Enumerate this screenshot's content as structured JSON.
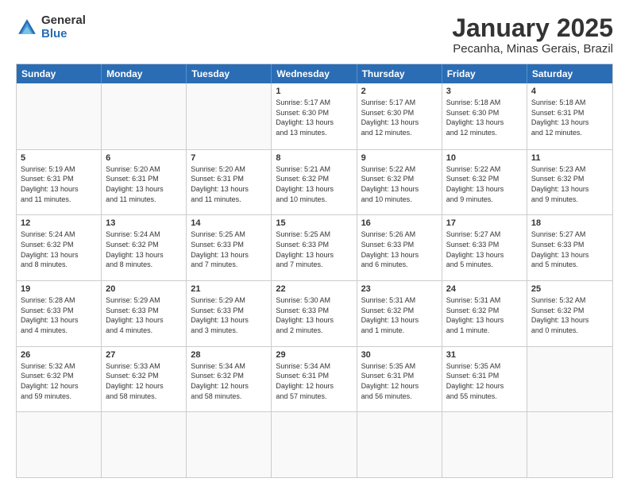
{
  "logo": {
    "general": "General",
    "blue": "Blue"
  },
  "header": {
    "title": "January 2025",
    "subtitle": "Pecanha, Minas Gerais, Brazil"
  },
  "weekdays": [
    "Sunday",
    "Monday",
    "Tuesday",
    "Wednesday",
    "Thursday",
    "Friday",
    "Saturday"
  ],
  "rows": [
    [
      {
        "day": "",
        "info": ""
      },
      {
        "day": "",
        "info": ""
      },
      {
        "day": "",
        "info": ""
      },
      {
        "day": "1",
        "info": "Sunrise: 5:17 AM\nSunset: 6:30 PM\nDaylight: 13 hours\nand 13 minutes."
      },
      {
        "day": "2",
        "info": "Sunrise: 5:17 AM\nSunset: 6:30 PM\nDaylight: 13 hours\nand 12 minutes."
      },
      {
        "day": "3",
        "info": "Sunrise: 5:18 AM\nSunset: 6:30 PM\nDaylight: 13 hours\nand 12 minutes."
      },
      {
        "day": "4",
        "info": "Sunrise: 5:18 AM\nSunset: 6:31 PM\nDaylight: 13 hours\nand 12 minutes."
      }
    ],
    [
      {
        "day": "5",
        "info": "Sunrise: 5:19 AM\nSunset: 6:31 PM\nDaylight: 13 hours\nand 11 minutes."
      },
      {
        "day": "6",
        "info": "Sunrise: 5:20 AM\nSunset: 6:31 PM\nDaylight: 13 hours\nand 11 minutes."
      },
      {
        "day": "7",
        "info": "Sunrise: 5:20 AM\nSunset: 6:31 PM\nDaylight: 13 hours\nand 11 minutes."
      },
      {
        "day": "8",
        "info": "Sunrise: 5:21 AM\nSunset: 6:32 PM\nDaylight: 13 hours\nand 10 minutes."
      },
      {
        "day": "9",
        "info": "Sunrise: 5:22 AM\nSunset: 6:32 PM\nDaylight: 13 hours\nand 10 minutes."
      },
      {
        "day": "10",
        "info": "Sunrise: 5:22 AM\nSunset: 6:32 PM\nDaylight: 13 hours\nand 9 minutes."
      },
      {
        "day": "11",
        "info": "Sunrise: 5:23 AM\nSunset: 6:32 PM\nDaylight: 13 hours\nand 9 minutes."
      }
    ],
    [
      {
        "day": "12",
        "info": "Sunrise: 5:24 AM\nSunset: 6:32 PM\nDaylight: 13 hours\nand 8 minutes."
      },
      {
        "day": "13",
        "info": "Sunrise: 5:24 AM\nSunset: 6:32 PM\nDaylight: 13 hours\nand 8 minutes."
      },
      {
        "day": "14",
        "info": "Sunrise: 5:25 AM\nSunset: 6:33 PM\nDaylight: 13 hours\nand 7 minutes."
      },
      {
        "day": "15",
        "info": "Sunrise: 5:25 AM\nSunset: 6:33 PM\nDaylight: 13 hours\nand 7 minutes."
      },
      {
        "day": "16",
        "info": "Sunrise: 5:26 AM\nSunset: 6:33 PM\nDaylight: 13 hours\nand 6 minutes."
      },
      {
        "day": "17",
        "info": "Sunrise: 5:27 AM\nSunset: 6:33 PM\nDaylight: 13 hours\nand 5 minutes."
      },
      {
        "day": "18",
        "info": "Sunrise: 5:27 AM\nSunset: 6:33 PM\nDaylight: 13 hours\nand 5 minutes."
      }
    ],
    [
      {
        "day": "19",
        "info": "Sunrise: 5:28 AM\nSunset: 6:33 PM\nDaylight: 13 hours\nand 4 minutes."
      },
      {
        "day": "20",
        "info": "Sunrise: 5:29 AM\nSunset: 6:33 PM\nDaylight: 13 hours\nand 4 minutes."
      },
      {
        "day": "21",
        "info": "Sunrise: 5:29 AM\nSunset: 6:33 PM\nDaylight: 13 hours\nand 3 minutes."
      },
      {
        "day": "22",
        "info": "Sunrise: 5:30 AM\nSunset: 6:33 PM\nDaylight: 13 hours\nand 2 minutes."
      },
      {
        "day": "23",
        "info": "Sunrise: 5:31 AM\nSunset: 6:32 PM\nDaylight: 13 hours\nand 1 minute."
      },
      {
        "day": "24",
        "info": "Sunrise: 5:31 AM\nSunset: 6:32 PM\nDaylight: 13 hours\nand 1 minute."
      },
      {
        "day": "25",
        "info": "Sunrise: 5:32 AM\nSunset: 6:32 PM\nDaylight: 13 hours\nand 0 minutes."
      }
    ],
    [
      {
        "day": "26",
        "info": "Sunrise: 5:32 AM\nSunset: 6:32 PM\nDaylight: 12 hours\nand 59 minutes."
      },
      {
        "day": "27",
        "info": "Sunrise: 5:33 AM\nSunset: 6:32 PM\nDaylight: 12 hours\nand 58 minutes."
      },
      {
        "day": "28",
        "info": "Sunrise: 5:34 AM\nSunset: 6:32 PM\nDaylight: 12 hours\nand 58 minutes."
      },
      {
        "day": "29",
        "info": "Sunrise: 5:34 AM\nSunset: 6:31 PM\nDaylight: 12 hours\nand 57 minutes."
      },
      {
        "day": "30",
        "info": "Sunrise: 5:35 AM\nSunset: 6:31 PM\nDaylight: 12 hours\nand 56 minutes."
      },
      {
        "day": "31",
        "info": "Sunrise: 5:35 AM\nSunset: 6:31 PM\nDaylight: 12 hours\nand 55 minutes."
      },
      {
        "day": "",
        "info": ""
      }
    ],
    [
      {
        "day": "",
        "info": ""
      },
      {
        "day": "",
        "info": ""
      },
      {
        "day": "",
        "info": ""
      },
      {
        "day": "",
        "info": ""
      },
      {
        "day": "",
        "info": ""
      },
      {
        "day": "",
        "info": ""
      },
      {
        "day": "",
        "info": ""
      }
    ]
  ]
}
